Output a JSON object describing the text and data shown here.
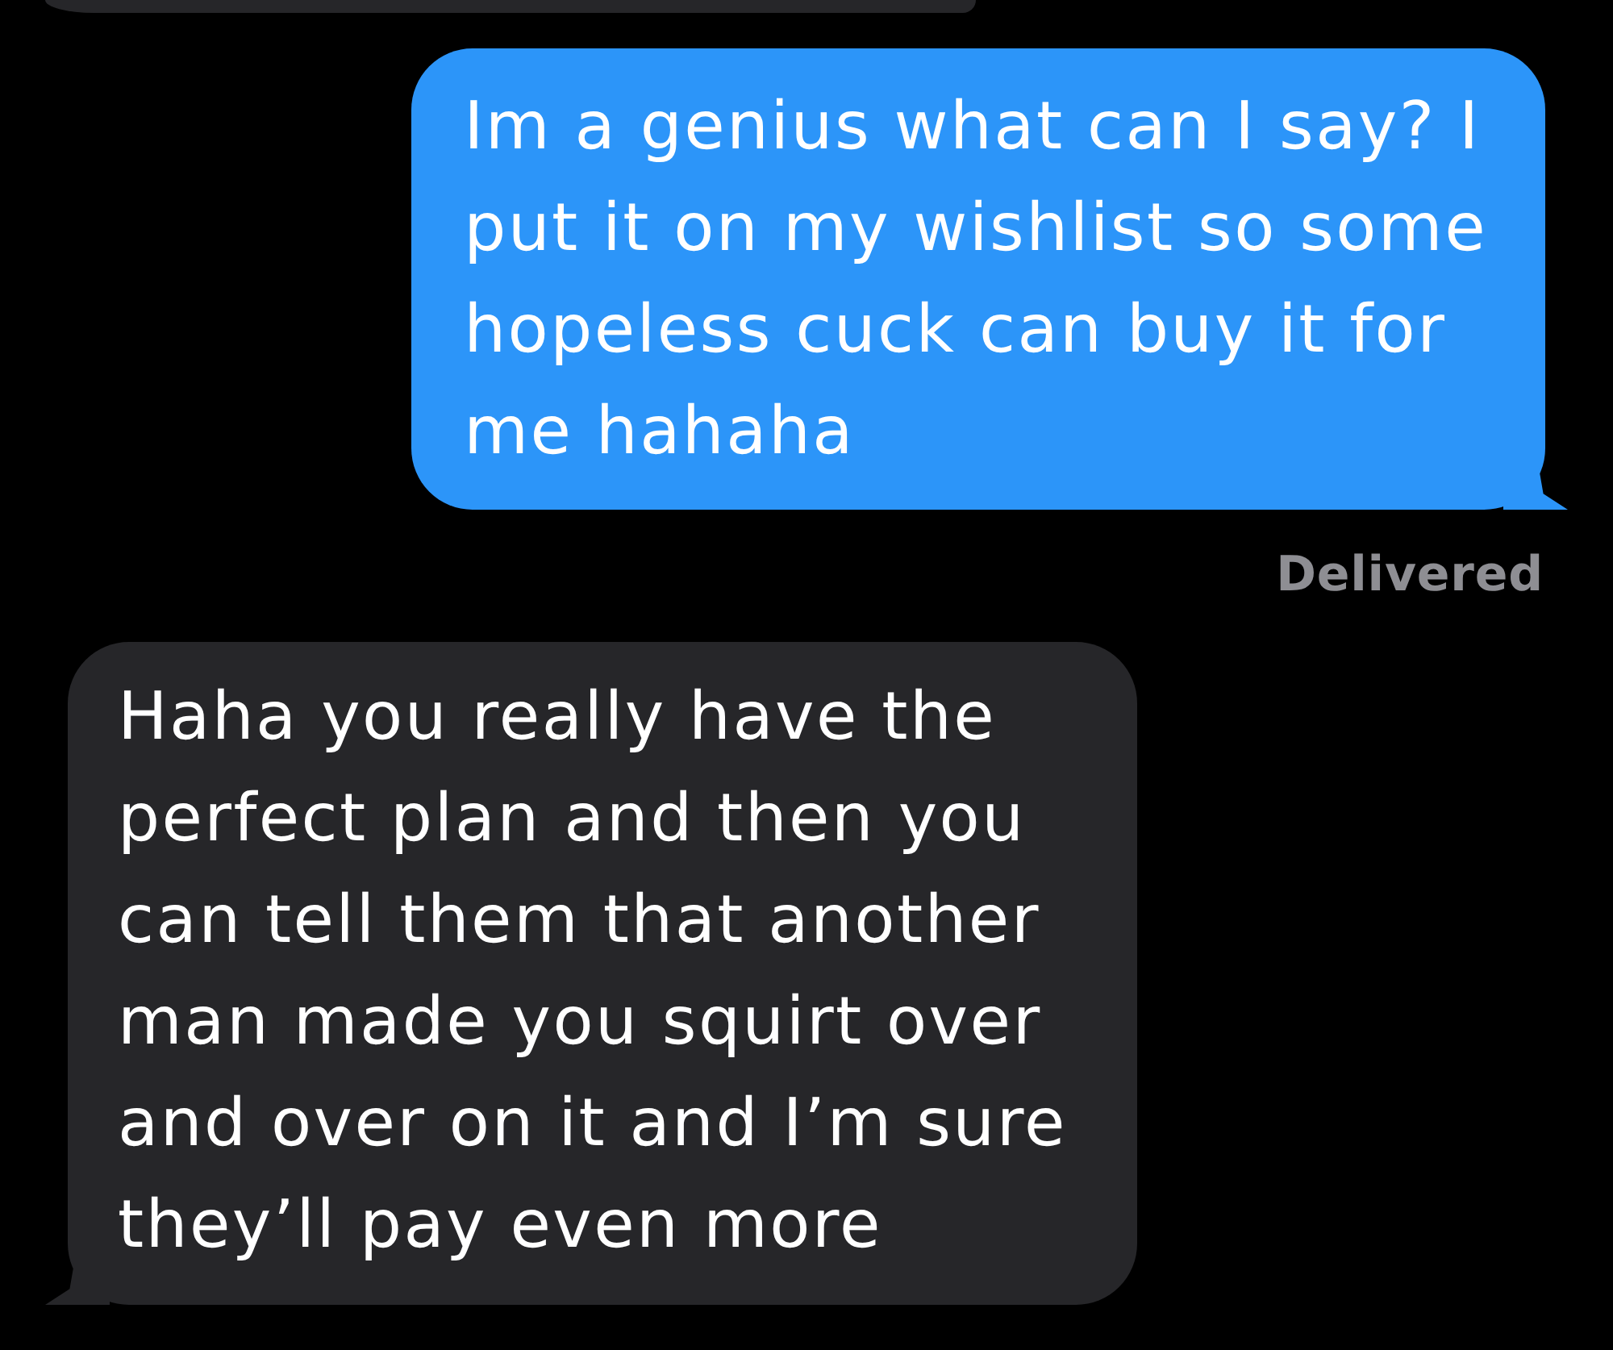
{
  "messages": [
    {
      "kind": "sent",
      "text": "Im a genius what can I say? I\nput it on my wishlist so some\nhopeless cuck can buy it for\nme hahaha",
      "status": "Delivered"
    },
    {
      "kind": "received",
      "text": "Haha you really have the\nperfect plan and then you\ncan tell them that another\nman made you squirt over\nand over on it and I’m sure\nthey’ll pay even more"
    }
  ]
}
